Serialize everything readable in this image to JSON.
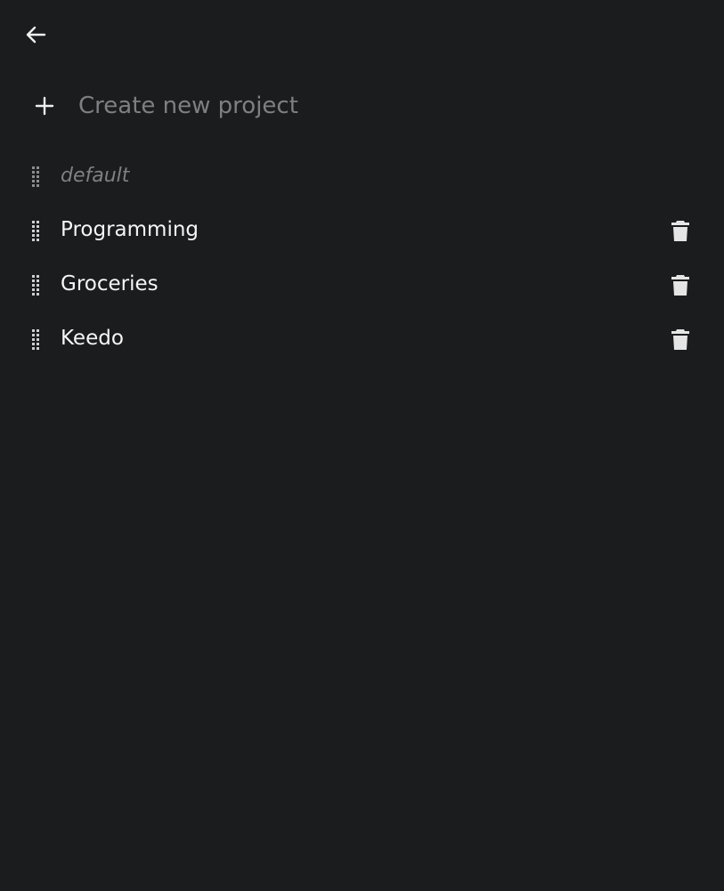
{
  "navigation": {
    "back_icon": "arrow-left-icon"
  },
  "create_project": {
    "add_icon": "plus-icon",
    "placeholder": "Create new project",
    "value": ""
  },
  "projects": [
    {
      "name": "default",
      "deletable": false,
      "drag_icon": "drag-handle-icon"
    },
    {
      "name": "Programming",
      "deletable": true,
      "drag_icon": "drag-handle-icon",
      "delete_icon": "trash-icon"
    },
    {
      "name": "Groceries",
      "deletable": true,
      "drag_icon": "drag-handle-icon",
      "delete_icon": "trash-icon"
    },
    {
      "name": "Keedo",
      "deletable": true,
      "drag_icon": "drag-handle-icon",
      "delete_icon": "trash-icon"
    }
  ],
  "colors": {
    "background": "#1b1c1e",
    "text": "#f5f5f5",
    "muted_text": "#7f8083",
    "icon": "#e5e5e5"
  }
}
